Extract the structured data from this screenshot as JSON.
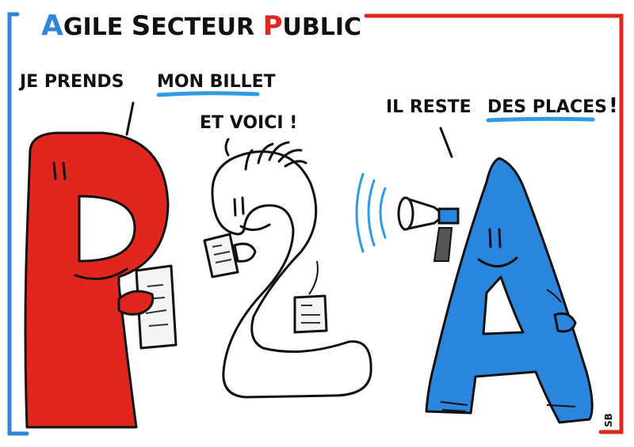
{
  "title": {
    "parts": [
      "A",
      "GILE ",
      "S",
      "ECTEUR ",
      "P",
      "UBLIC"
    ],
    "colors": {
      "a_letter": "#2f86d6",
      "p_letter": "#e0261f",
      "text": "#111111"
    }
  },
  "speech": {
    "p": {
      "line1": "JE PRENDS",
      "underlined": "MON BILLET"
    },
    "two": {
      "text": "ET VOICI !"
    },
    "a": {
      "before": "IL RESTE",
      "underlined": "DES PLACES",
      "after": "!"
    }
  },
  "signature": "SB",
  "colors": {
    "frame_red": "#e0261f",
    "frame_blue": "#2f86d6",
    "p_body": "#e0261f",
    "a_body": "#2a86dc",
    "underline_blue": "#2f9be6"
  }
}
